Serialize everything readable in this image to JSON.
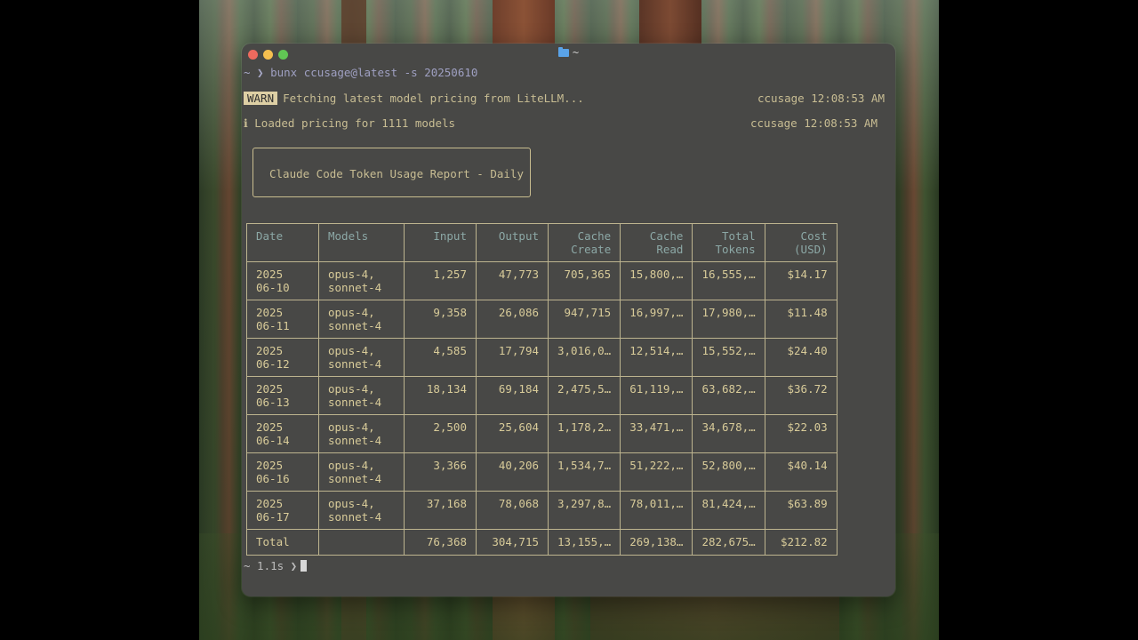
{
  "terminal": {
    "title": "~",
    "command_prompt": "~ ❯",
    "command": "bunx ccusage@latest -s 20250610",
    "warn": {
      "badge": "WARN",
      "message": "Fetching latest model pricing from LiteLLM...",
      "timestamp": "ccusage 12:08:53 AM"
    },
    "info": {
      "icon": "ℹ",
      "message": "Loaded pricing for 1111 models",
      "timestamp": "ccusage 12:08:53 AM"
    },
    "report_title": "Claude Code Token Usage Report - Daily",
    "end_prompt": "~ 1.1s ❯"
  },
  "table": {
    "headers": [
      [
        "Date"
      ],
      [
        "Models"
      ],
      [
        "Input"
      ],
      [
        "Output"
      ],
      [
        "Cache",
        "Create"
      ],
      [
        "Cache",
        "Read"
      ],
      [
        "Total",
        "Tokens"
      ],
      [
        "Cost",
        "(USD)"
      ]
    ],
    "rows": [
      {
        "date": [
          "2025",
          "06-10"
        ],
        "models": [
          "opus-4,",
          "sonnet-4"
        ],
        "input": "1,257",
        "output": "47,773",
        "cache_create": "705,365",
        "cache_read": "15,800,…",
        "total": "16,555,…",
        "cost": "$14.17"
      },
      {
        "date": [
          "2025",
          "06-11"
        ],
        "models": [
          "opus-4,",
          "sonnet-4"
        ],
        "input": "9,358",
        "output": "26,086",
        "cache_create": "947,715",
        "cache_read": "16,997,…",
        "total": "17,980,…",
        "cost": "$11.48"
      },
      {
        "date": [
          "2025",
          "06-12"
        ],
        "models": [
          "opus-4,",
          "sonnet-4"
        ],
        "input": "4,585",
        "output": "17,794",
        "cache_create": "3,016,0…",
        "cache_read": "12,514,…",
        "total": "15,552,…",
        "cost": "$24.40"
      },
      {
        "date": [
          "2025",
          "06-13"
        ],
        "models": [
          "opus-4,",
          "sonnet-4"
        ],
        "input": "18,134",
        "output": "69,184",
        "cache_create": "2,475,5…",
        "cache_read": "61,119,…",
        "total": "63,682,…",
        "cost": "$36.72"
      },
      {
        "date": [
          "2025",
          "06-14"
        ],
        "models": [
          "opus-4,",
          "sonnet-4"
        ],
        "input": "2,500",
        "output": "25,604",
        "cache_create": "1,178,2…",
        "cache_read": "33,471,…",
        "total": "34,678,…",
        "cost": "$22.03"
      },
      {
        "date": [
          "2025",
          "06-16"
        ],
        "models": [
          "opus-4,",
          "sonnet-4"
        ],
        "input": "3,366",
        "output": "40,206",
        "cache_create": "1,534,7…",
        "cache_read": "51,222,…",
        "total": "52,800,…",
        "cost": "$40.14"
      },
      {
        "date": [
          "2025",
          "06-17"
        ],
        "models": [
          "opus-4,",
          "sonnet-4"
        ],
        "input": "37,168",
        "output": "78,068",
        "cache_create": "3,297,8…",
        "cache_read": "78,011,…",
        "total": "81,424,…",
        "cost": "$63.89"
      }
    ],
    "total": {
      "label": "Total",
      "models": "",
      "input": "76,368",
      "output": "304,715",
      "cache_create": "13,155,…",
      "cache_read": "269,138…",
      "total": "282,675…",
      "cost": "$212.82"
    }
  },
  "colors": {
    "terminal_bg": "#484846",
    "text_yellow": "#d8cb99",
    "header_teal": "#8ca8a6",
    "warn_badge_bg": "#ddcfa4"
  }
}
